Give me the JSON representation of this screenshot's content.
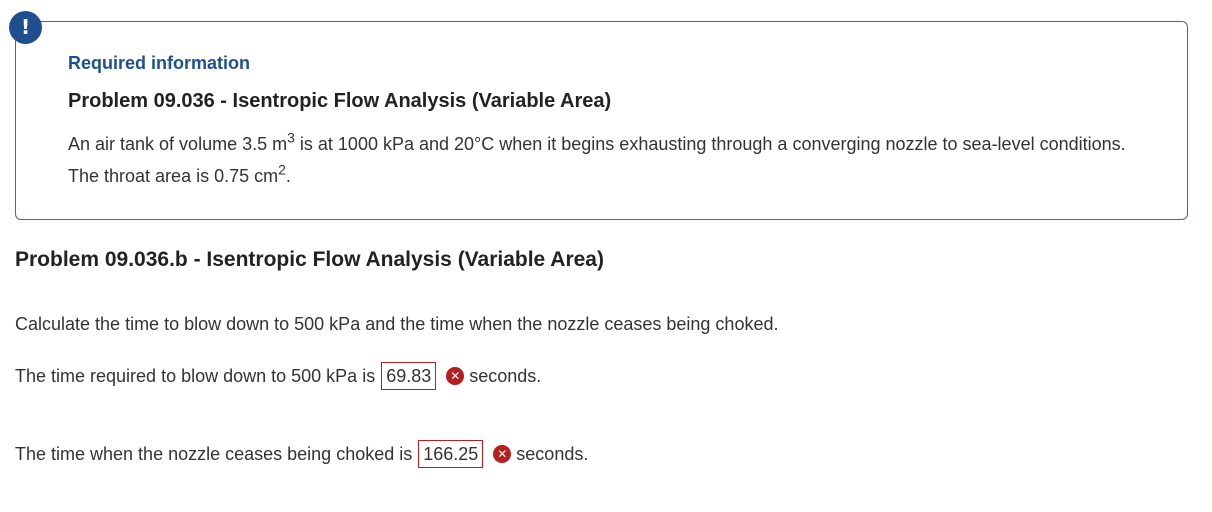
{
  "info": {
    "badge": "!",
    "required_label": "Required information",
    "title": "Problem 09.036 - Isentropic Flow Analysis (Variable Area)",
    "body_part1": "An air tank of volume 3.5 m",
    "body_sup1": "3",
    "body_part2": " is at 1000 kPa and 20°C when it begins exhausting through a converging nozzle to sea-level conditions. The throat area is 0.75 cm",
    "body_sup2": "2",
    "body_part3": "."
  },
  "part": {
    "title": "Problem 09.036.b - Isentropic Flow Analysis (Variable Area)",
    "question": "Calculate the time to blow down to 500 kPa and the time when the nozzle ceases being choked.",
    "answers": [
      {
        "prefix": "The time required to blow down to 500 kPa is",
        "value": "69.83",
        "status_icon": "incorrect-x-icon",
        "unit": "seconds."
      },
      {
        "prefix": "The time when the nozzle ceases being choked is",
        "value": "166.25",
        "status_icon": "incorrect-x-icon",
        "unit": "seconds."
      }
    ]
  },
  "colors": {
    "accent_blue": "#1f4f8f",
    "error_red": "#b51f1f"
  }
}
